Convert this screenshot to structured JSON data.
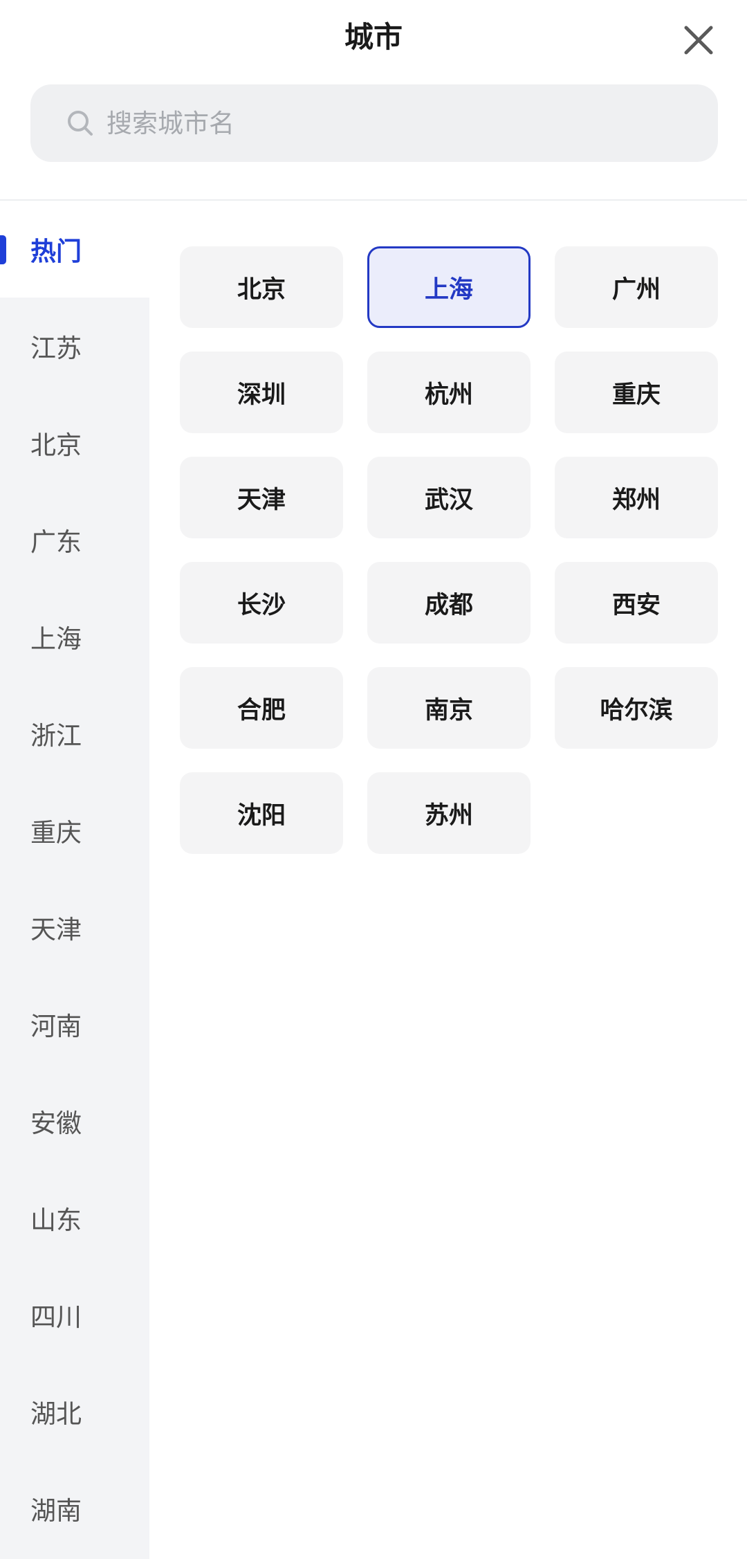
{
  "header": {
    "title": "城市"
  },
  "search": {
    "placeholder": "搜索城市名"
  },
  "sidebar": {
    "items": [
      {
        "label": "热门",
        "active": true
      },
      {
        "label": "江苏"
      },
      {
        "label": "北京"
      },
      {
        "label": "广东"
      },
      {
        "label": "上海"
      },
      {
        "label": "浙江"
      },
      {
        "label": "重庆"
      },
      {
        "label": "天津"
      },
      {
        "label": "河南"
      },
      {
        "label": "安徽"
      },
      {
        "label": "山东"
      },
      {
        "label": "四川"
      },
      {
        "label": "湖北"
      },
      {
        "label": "湖南"
      }
    ]
  },
  "cities": [
    {
      "label": "北京"
    },
    {
      "label": "上海",
      "selected": true
    },
    {
      "label": "广州"
    },
    {
      "label": "深圳"
    },
    {
      "label": "杭州"
    },
    {
      "label": "重庆"
    },
    {
      "label": "天津"
    },
    {
      "label": "武汉"
    },
    {
      "label": "郑州"
    },
    {
      "label": "长沙"
    },
    {
      "label": "成都"
    },
    {
      "label": "西安"
    },
    {
      "label": "合肥"
    },
    {
      "label": "南京"
    },
    {
      "label": "哈尔滨"
    },
    {
      "label": "沈阳"
    },
    {
      "label": "苏州"
    }
  ],
  "colors": {
    "accent": "#1f3fd8",
    "selected_bg": "#ebedfb",
    "sidebar_bg": "#f3f4f6",
    "tile_bg": "#f4f4f5"
  },
  "icons": {
    "close": "close-icon",
    "search": "search-icon"
  }
}
